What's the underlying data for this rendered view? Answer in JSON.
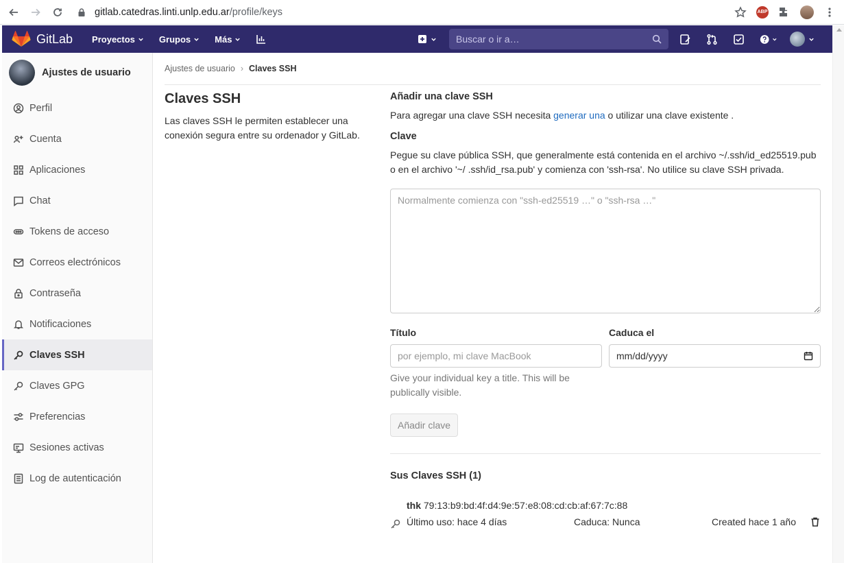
{
  "browser": {
    "url_host": "gitlab.catedras.linti.unlp.edu.ar",
    "url_path": "/profile/keys",
    "abp_label": "ABP"
  },
  "topnav": {
    "brand": "GitLab",
    "menu": [
      "Proyectos",
      "Grupos",
      "Más"
    ],
    "search_placeholder": "Buscar o ir a…"
  },
  "sidebar": {
    "title": "Ajustes de usuario",
    "items": [
      {
        "label": "Perfil",
        "icon": "profile-icon"
      },
      {
        "label": "Cuenta",
        "icon": "account-icon"
      },
      {
        "label": "Aplicaciones",
        "icon": "applications-icon"
      },
      {
        "label": "Chat",
        "icon": "chat-icon"
      },
      {
        "label": "Tokens de acceso",
        "icon": "token-icon"
      },
      {
        "label": "Correos electrónicos",
        "icon": "mail-icon"
      },
      {
        "label": "Contraseña",
        "icon": "lock-icon"
      },
      {
        "label": "Notificaciones",
        "icon": "bell-icon"
      },
      {
        "label": "Claves SSH",
        "icon": "key-icon",
        "active": true
      },
      {
        "label": "Claves GPG",
        "icon": "key-icon"
      },
      {
        "label": "Preferencias",
        "icon": "preferences-icon"
      },
      {
        "label": "Sesiones activas",
        "icon": "monitor-icon"
      },
      {
        "label": "Log de autenticación",
        "icon": "log-icon"
      }
    ]
  },
  "breadcrumb": {
    "parent": "Ajustes de usuario",
    "current": "Claves SSH"
  },
  "intro": {
    "title": "Claves SSH",
    "description": "Las claves SSH le permiten establecer una conexión segura entre su ordenador y GitLab."
  },
  "add_key": {
    "heading": "Añadir una clave SSH",
    "text_before": "Para agregar una clave SSH necesita ",
    "link": "generar una",
    "text_after": " o utilizar una clave existente .",
    "key_label": "Clave",
    "key_help": "Pegue su clave pública SSH, que generalmente está contenida en el archivo ~/.ssh/id_ed25519.pub o en el archivo '~/ .ssh/id_rsa.pub' y comienza con 'ssh-rsa'. No utilice su clave SSH privada.",
    "key_placeholder": "Normalmente comienza con \"ssh-ed25519 …\" o \"ssh-rsa …\"",
    "title_label": "Título",
    "title_placeholder": "por ejemplo, mi clave MacBook",
    "title_help": "Give your individual key a title. This will be publically visible.",
    "expires_label": "Caduca el",
    "expires_placeholder": "mm/dd/yyyy",
    "submit": "Añadir clave"
  },
  "keys": {
    "heading": "Sus Claves SSH (1)",
    "items": [
      {
        "title": "thk",
        "fingerprint": "79:13:b9:bd:4f:d4:9e:57:e8:08:cd:cb:af:67:7c:88",
        "last_used": "Último uso: hace 4 días",
        "expires": "Caduca: Nunca",
        "created": "Created hace 1 año"
      }
    ]
  },
  "colors": {
    "nav_bg": "#2f2a6b",
    "link": "#1f6bbf",
    "active_accent": "#6666c4"
  }
}
